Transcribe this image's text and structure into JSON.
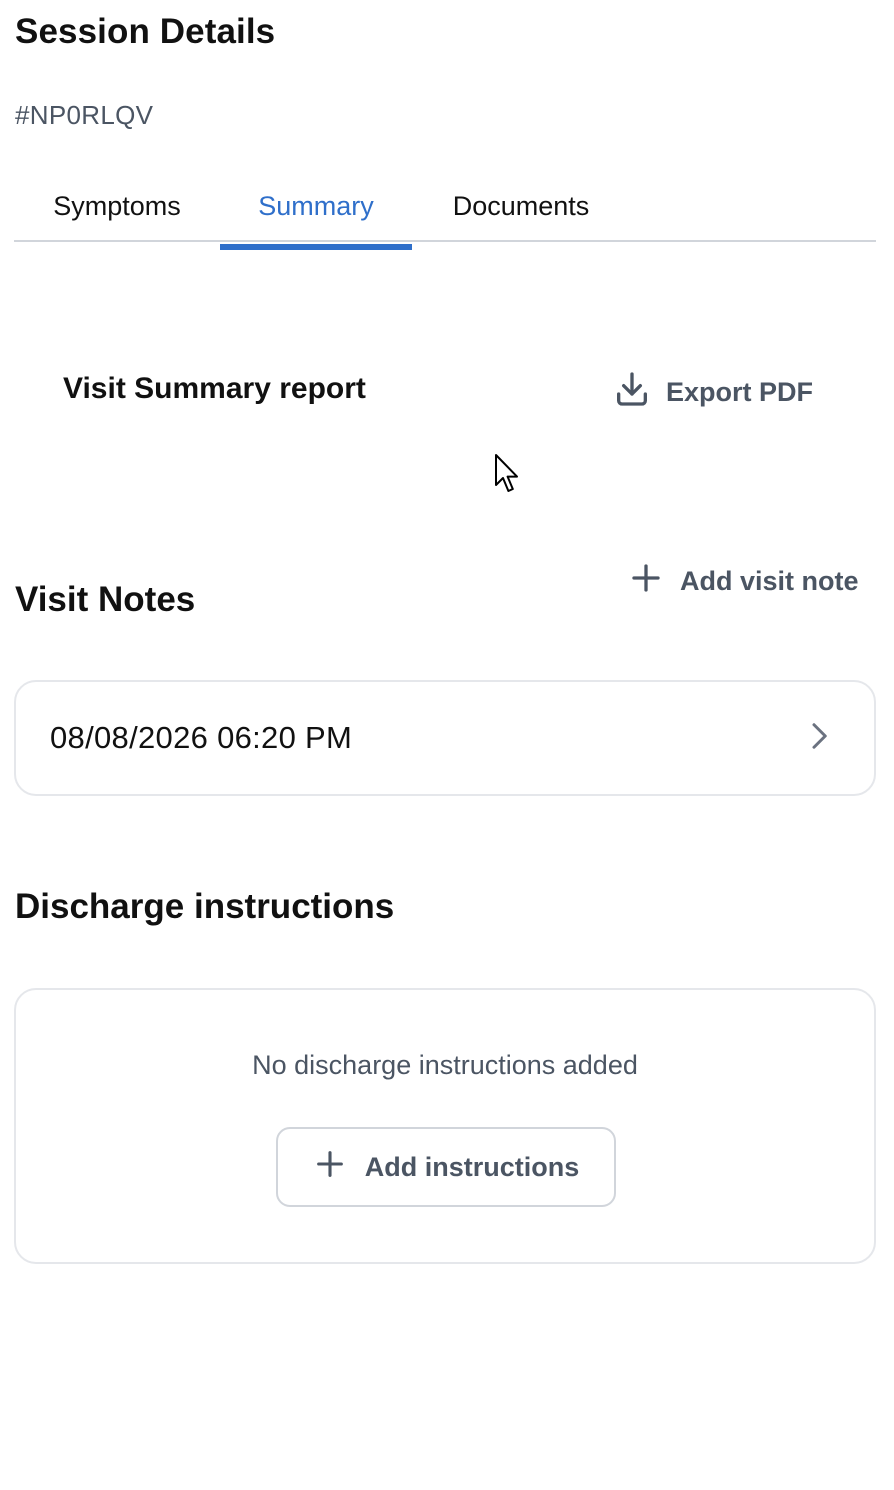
{
  "header": {
    "title": "Session Details",
    "session_id": "#NP0RLQV"
  },
  "tabs": [
    {
      "label": "Symptoms",
      "active": false
    },
    {
      "label": "Summary",
      "active": true
    },
    {
      "label": "Documents",
      "active": false
    }
  ],
  "summary_report": {
    "title": "Visit Summary report",
    "export_label": "Export PDF",
    "export_icon": "download-icon"
  },
  "visit_notes": {
    "title": "Visit Notes",
    "add_label": "Add visit note",
    "add_icon": "plus-icon",
    "items": [
      {
        "datetime": "08/08/2026 06:20 PM",
        "icon": "chevron-right-icon"
      }
    ]
  },
  "discharge": {
    "title": "Discharge instructions",
    "empty_text": "No discharge instructions added",
    "add_label": "Add instructions",
    "add_icon": "plus-icon"
  },
  "colors": {
    "accent": "#2f6fca",
    "text_primary": "#111111",
    "text_secondary": "#4b5563",
    "border": "#e5e7eb"
  }
}
